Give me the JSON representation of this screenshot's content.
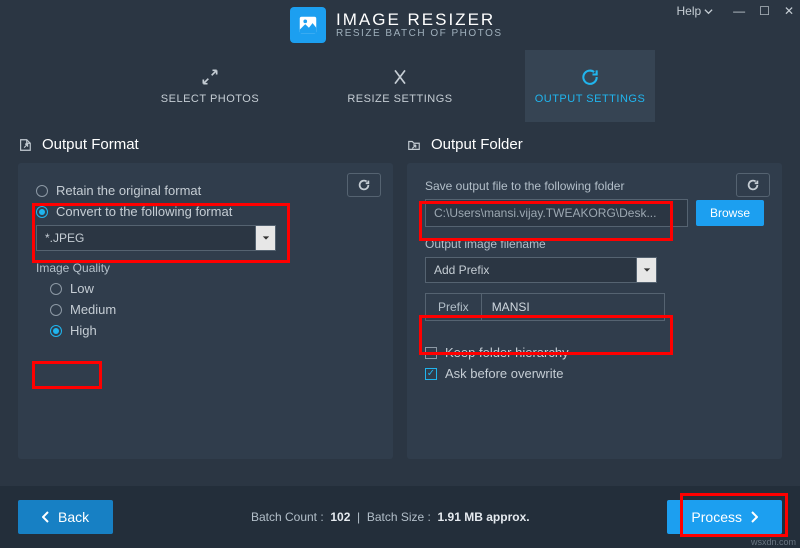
{
  "app": {
    "title": "IMAGE RESIZER",
    "subtitle": "RESIZE BATCH OF PHOTOS",
    "help": "Help"
  },
  "tabs": {
    "select": "SELECT PHOTOS",
    "resize": "RESIZE SETTINGS",
    "output": "OUTPUT SETTINGS"
  },
  "format": {
    "heading": "Output Format",
    "retain": "Retain the original format",
    "convert": "Convert to the following format",
    "selected": "*.JPEG",
    "quality_label": "Image Quality",
    "low": "Low",
    "medium": "Medium",
    "high": "High"
  },
  "folder": {
    "heading": "Output Folder",
    "save_label": "Save output file to the following folder",
    "path": "C:\\Users\\mansi.vijay.TWEAKORG\\Desk...",
    "browse": "Browse",
    "filename_label": "Output image filename",
    "mode": "Add Prefix",
    "prefix_label": "Prefix",
    "prefix_value": "MANSI",
    "keep_hierarchy": "Keep folder hierarchy",
    "ask_overwrite": "Ask before overwrite"
  },
  "footer": {
    "back": "Back",
    "process": "Process",
    "count_label": "Batch Count :",
    "count": "102",
    "size_label": "Batch Size :",
    "size": "1.91 MB approx."
  },
  "watermark": "wsxdn.com"
}
